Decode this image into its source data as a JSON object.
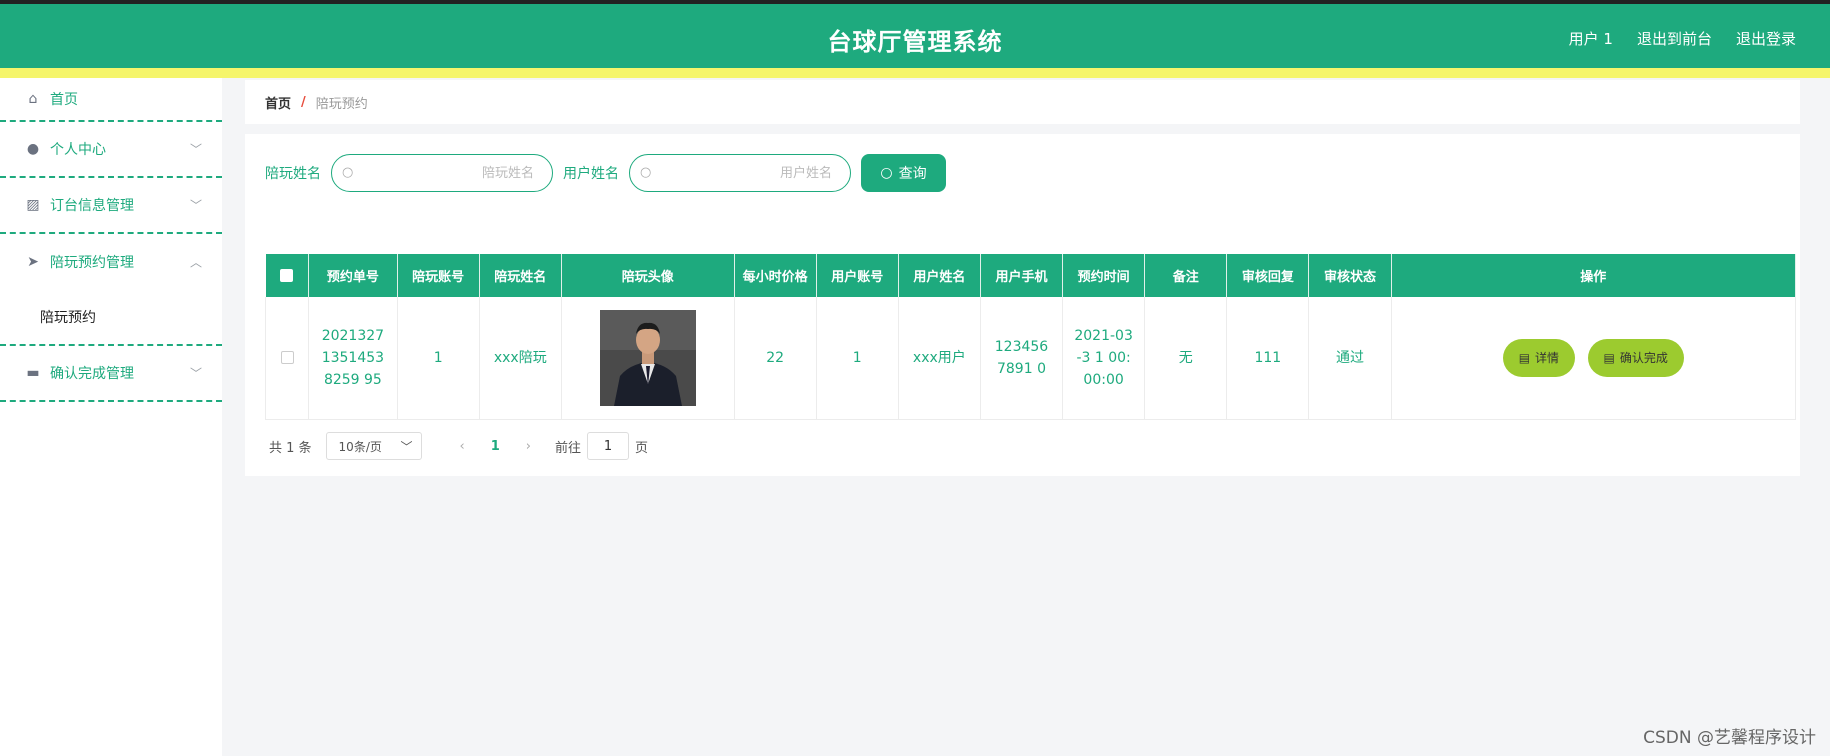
{
  "header": {
    "title": "台球厅管理系统",
    "user": "用户 1",
    "back_front": "退出到前台",
    "logout": "退出登录"
  },
  "sidebar": {
    "items": [
      {
        "label": "首页",
        "icon": "home-icon"
      },
      {
        "label": "个人中心",
        "icon": "user-icon"
      },
      {
        "label": "订台信息管理",
        "icon": "chart-icon"
      },
      {
        "label": "陪玩预约管理",
        "icon": "send-icon"
      },
      {
        "label": "确认完成管理",
        "icon": "box-icon"
      }
    ],
    "submenu": "陪玩预约"
  },
  "breadcrumb": {
    "home": "首页",
    "sep": "/",
    "current": "陪玩预约"
  },
  "search": {
    "label1": "陪玩姓名",
    "placeholder1": "陪玩姓名",
    "label2": "用户姓名",
    "placeholder2": "用户姓名",
    "button": "查询"
  },
  "table": {
    "headers": [
      "预约单号",
      "陪玩账号",
      "陪玩姓名",
      "陪玩头像",
      "每小时价格",
      "用户账号",
      "用户姓名",
      "用户手机",
      "预约时间",
      "备注",
      "审核回复",
      "审核状态",
      "操作"
    ],
    "rows": [
      {
        "order_no": "202132713514538259 95",
        "player_account": "1",
        "player_name": "xxx陪玩",
        "price": "22",
        "user_account": "1",
        "user_name": "xxx用户",
        "user_phone": "1234567891 0",
        "time": "2021-03-3 1 00:00:00",
        "remark": "无",
        "reply": "111",
        "status": "通过",
        "btn_detail": "详情",
        "btn_confirm": "确认完成"
      }
    ]
  },
  "pager": {
    "total": "共 1 条",
    "size": "10条/页",
    "prev": "‹",
    "page": "1",
    "next": "›",
    "goto_label": "前往",
    "goto_value": "1",
    "page_suffix": "页"
  },
  "watermark": "CSDN @艺馨程序设计",
  "colors": {
    "primary": "#1eaa7e",
    "accent_strip": "#f5f56b",
    "action_button": "#9ccb2f"
  }
}
